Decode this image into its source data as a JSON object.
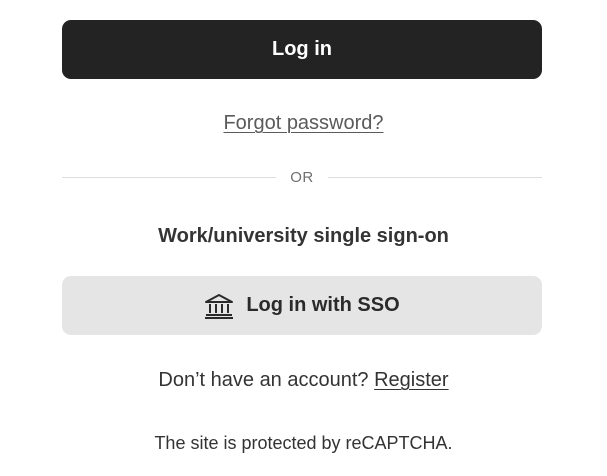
{
  "login": {
    "button_label": "Log in",
    "forgot_password": "Forgot password?"
  },
  "divider": {
    "text": "OR"
  },
  "sso": {
    "heading": "Work/university single sign-on",
    "button_label": "Log in with SSO",
    "icon": "bank-icon"
  },
  "register": {
    "prompt": "Don’t have an account?",
    "link_label": "Register"
  },
  "footer": {
    "recaptcha_text": "The site is protected by reCAPTCHA."
  }
}
